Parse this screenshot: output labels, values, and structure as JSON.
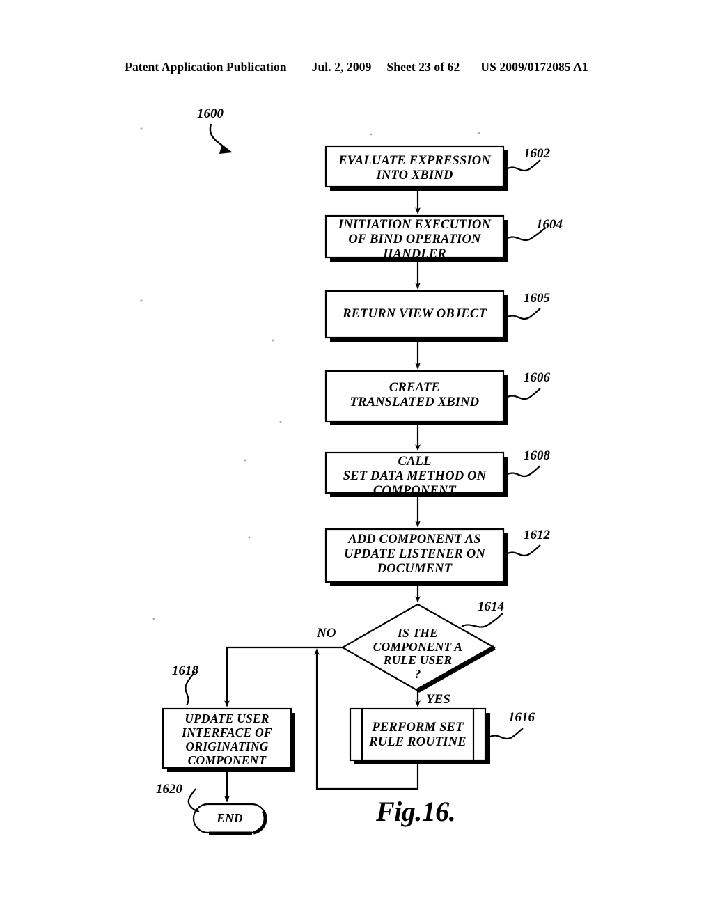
{
  "header": {
    "publication": "Patent Application Publication",
    "date": "Jul. 2, 2009",
    "sheet": "Sheet 23 of 62",
    "patent_number": "US 2009/0172085 A1"
  },
  "figure": {
    "caption": "Fig.16.",
    "diagram_ref": "1600",
    "type": "flowchart"
  },
  "nodes": [
    {
      "id": "n1602",
      "ref": "1602",
      "shape": "process",
      "text": "EVALUATE EXPRESSION\nINTO XBIND"
    },
    {
      "id": "n1604",
      "ref": "1604",
      "shape": "process",
      "text": "INITIATION EXECUTION\nOF BIND OPERATION\nHANDLER"
    },
    {
      "id": "n1605",
      "ref": "1605",
      "shape": "process",
      "text": "RETURN VIEW OBJECT"
    },
    {
      "id": "n1606",
      "ref": "1606",
      "shape": "process",
      "text": "CREATE\nTRANSLATED XBIND"
    },
    {
      "id": "n1608",
      "ref": "1608",
      "shape": "process",
      "text": "CALL\nSET DATA METHOD ON\nCOMPONENT"
    },
    {
      "id": "n1612",
      "ref": "1612",
      "shape": "process",
      "text": "ADD COMPONENT AS\nUPDATE LISTENER ON\nDOCUMENT"
    },
    {
      "id": "n1614",
      "ref": "1614",
      "shape": "decision",
      "text": "IS THE\nCOMPONENT A\nRULE USER\n?"
    },
    {
      "id": "n1616",
      "ref": "1616",
      "shape": "predefined-process",
      "text": "PERFORM SET\nRULE ROUTINE"
    },
    {
      "id": "n1618",
      "ref": "1618",
      "shape": "process",
      "text": "UPDATE USER\nINTERFACE OF\nORIGINATING\nCOMPONENT"
    },
    {
      "id": "n1620",
      "ref": "1620",
      "shape": "terminator",
      "text": "END"
    }
  ],
  "edge_labels": {
    "no": "NO",
    "yes": "YES"
  },
  "colors": {
    "ink": "#000000",
    "paper": "#ffffff"
  }
}
